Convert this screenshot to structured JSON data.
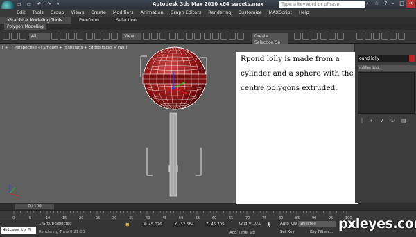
{
  "titlebar": {
    "title": "Autodesk 3ds Max  2010 x64      sweets.max",
    "search_placeholder": "Type a keyword or phrase",
    "window_buttons": [
      "–",
      "□",
      "✕"
    ]
  },
  "menu": [
    "Edit",
    "Tools",
    "Group",
    "Views",
    "Create",
    "Modifiers",
    "Animation",
    "Graph Editors",
    "Rendering",
    "Customize",
    "MAXScript",
    "Help"
  ],
  "ribbon": {
    "tabs": [
      "Graphite Modeling Tools",
      "Freeform",
      "Selection"
    ],
    "sub_tab": "Polygon Modeling"
  },
  "toolbar": {
    "filter": "All",
    "view": "View",
    "selection_set": "Create Selection Se"
  },
  "viewport": {
    "label": "[ + ] [ Perspective ] [ Smooth + Highlights + Edged Faces + HW ]"
  },
  "annotation": {
    "lines": [
      "Rpond lolly is made from a",
      "cylinder and a sphere with the",
      "centre polygons extruded."
    ]
  },
  "command_panel": {
    "object_name": "ound lolly",
    "object_color": "#c02020",
    "modifier_list": "odifier List"
  },
  "timeline": {
    "slider": "0 / 100",
    "ticks": [
      "0",
      "5",
      "10",
      "15",
      "20",
      "25",
      "30",
      "35",
      "40",
      "45",
      "50",
      "55",
      "60",
      "65",
      "70",
      "75",
      "80",
      "85",
      "90",
      "95",
      "100"
    ]
  },
  "status": {
    "welcome": "Welcome to M",
    "selection": "1 Group Selected",
    "render_time": "Rendering Time  0:21:00",
    "x": "45.076",
    "y": "-32.684",
    "z": "46.709",
    "grid": "Grid = 10.0",
    "auto_key": "Auto Key",
    "set_key": "Set Key",
    "selected": "Selected",
    "key_filters": "Key Filters...",
    "add_time_tag": "Add Time Tag"
  },
  "watermark": "pxleyes.com"
}
